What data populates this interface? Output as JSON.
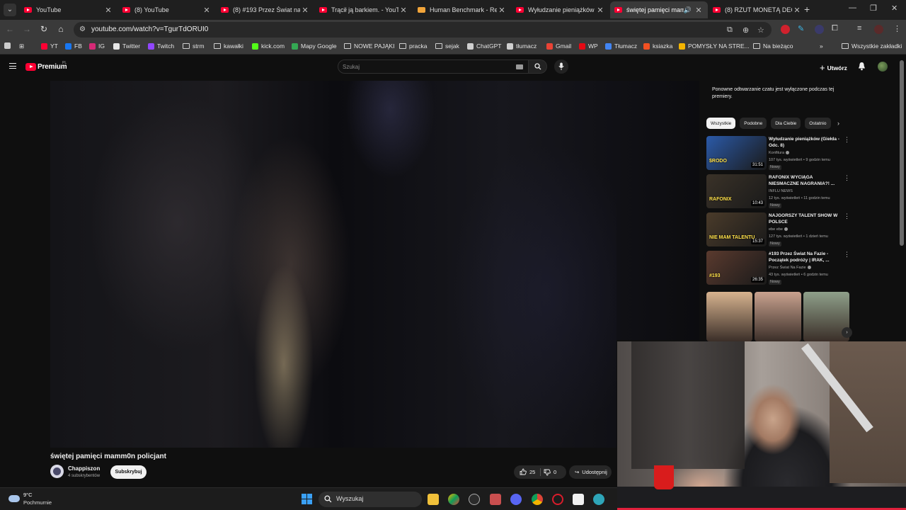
{
  "browser": {
    "tabs": [
      {
        "title": "YouTube",
        "active": false
      },
      {
        "title": "(8) YouTube",
        "active": false
      },
      {
        "title": "(8) #193 Przez Świat na Fa",
        "active": false
      },
      {
        "title": "Trącił ją barkiem. - YouTu",
        "active": false
      },
      {
        "title": "Human Benchmark - Reac",
        "active": false
      },
      {
        "title": "Wyłudzanie pieniążków (",
        "active": false
      },
      {
        "title": "świętej pamięci mam",
        "active": true
      },
      {
        "title": "(8) RZUT MONETĄ DECY",
        "active": false
      }
    ],
    "new_tab": "+",
    "url": "youtube.com/watch?v=TgurTdORUI0",
    "bookmarks": [
      {
        "label": "YT",
        "color": "#ff0033"
      },
      {
        "label": "FB",
        "color": "#1877f2"
      },
      {
        "label": "IG",
        "color": "#d62976"
      },
      {
        "label": "Twitter",
        "color": "#e7e7e7"
      },
      {
        "label": "Twitch",
        "color": "#9146ff"
      },
      {
        "label": "strm",
        "color": "folder"
      },
      {
        "label": "kawałki",
        "color": "folder"
      },
      {
        "label": "kick.com",
        "color": "#53fc18"
      },
      {
        "label": "Mapy Google",
        "color": "#34a853"
      },
      {
        "label": "NOWE PAJĄKI",
        "color": "folder"
      },
      {
        "label": "pracka",
        "color": "folder"
      },
      {
        "label": "sejak",
        "color": "folder"
      },
      {
        "label": "ChatGPT",
        "color": "#cfcfcf"
      },
      {
        "label": "tłumacz",
        "color": "#cfcfcf"
      },
      {
        "label": "Gmail",
        "color": "#ea4335"
      },
      {
        "label": "WP",
        "color": "#e50914"
      },
      {
        "label": "Tłumacz",
        "color": "#4285f4"
      },
      {
        "label": "ksiazka",
        "color": "#f25022"
      },
      {
        "label": "POMYSŁY NA STRE...",
        "color": "#f4b400"
      },
      {
        "label": "Na bieżąco",
        "color": "folder"
      }
    ],
    "bookmarks_overflow": "»",
    "all_bookmarks": "Wszystkie zakładki"
  },
  "youtube": {
    "logo_text": "Premium",
    "country": "PL",
    "search_placeholder": "Szukaj",
    "create_label": "Utwórz",
    "video": {
      "title": "świętej pamięci mamm0n policjant",
      "channel": "Chappiszon",
      "subscribers": "4 subskrybentów",
      "subscribe_label": "Subskrybuj",
      "likes": "25",
      "dislikes": "0",
      "share_label": "Udostępnij"
    },
    "sidebar": {
      "premiere_note": "Ponowne odtwarzanie czatu jest wyłączone podczas tej premiery.",
      "chips": [
        "Wszystkie",
        "Podobne",
        "Dla Ciebie",
        "Ostatnio"
      ],
      "recommendations": [
        {
          "title": "Wyłudzanie pieniążków (Giełda - Odc. 8)",
          "channel": "Konfitura",
          "verified": true,
          "meta": "107 tys. wyświetleń • 9 godzin temu",
          "badge": "Nowy",
          "duration": "31:51",
          "thumb_text": "$RODO",
          "thumb_color": "#2b5aa8"
        },
        {
          "title": "RAFONIX WYCIĄGA NIESMACZNE NAGRANIA?! ...",
          "channel": "INFLU NEWS",
          "verified": false,
          "meta": "12 tys. wyświetleń • 11 godzin temu",
          "badge": "Nowy",
          "duration": "10:43",
          "thumb_text": "RAFONIX",
          "thumb_color": "#3a3228"
        },
        {
          "title": "NAJGORSZY TALENT SHOW W POLSCE",
          "channel": "ebe ebe",
          "verified": true,
          "meta": "127 tys. wyświetleń • 1 dzień temu",
          "badge": "Nowy",
          "duration": "15:37",
          "thumb_text": "NIE MAM TALENTU",
          "thumb_color": "#4a3b2a"
        },
        {
          "title": "#193 Przez Świat Na Fazie - Początek podróży | IRAK, ...",
          "channel": "Przez Świat Na Fazie",
          "verified": true,
          "meta": "43 tys. wyświetleń • 6 godzin temu",
          "badge": "Nowy",
          "duration": "26:35",
          "thumb_text": "#193",
          "thumb_color": "#5a3a2e"
        }
      ],
      "shorts_colors": [
        "#d7b38f",
        "#c9a28f",
        "#8fa08a"
      ]
    }
  },
  "taskbar": {
    "temperature": "9°C",
    "weather": "Pochmurnie",
    "search_placeholder": "Wyszukaj"
  }
}
